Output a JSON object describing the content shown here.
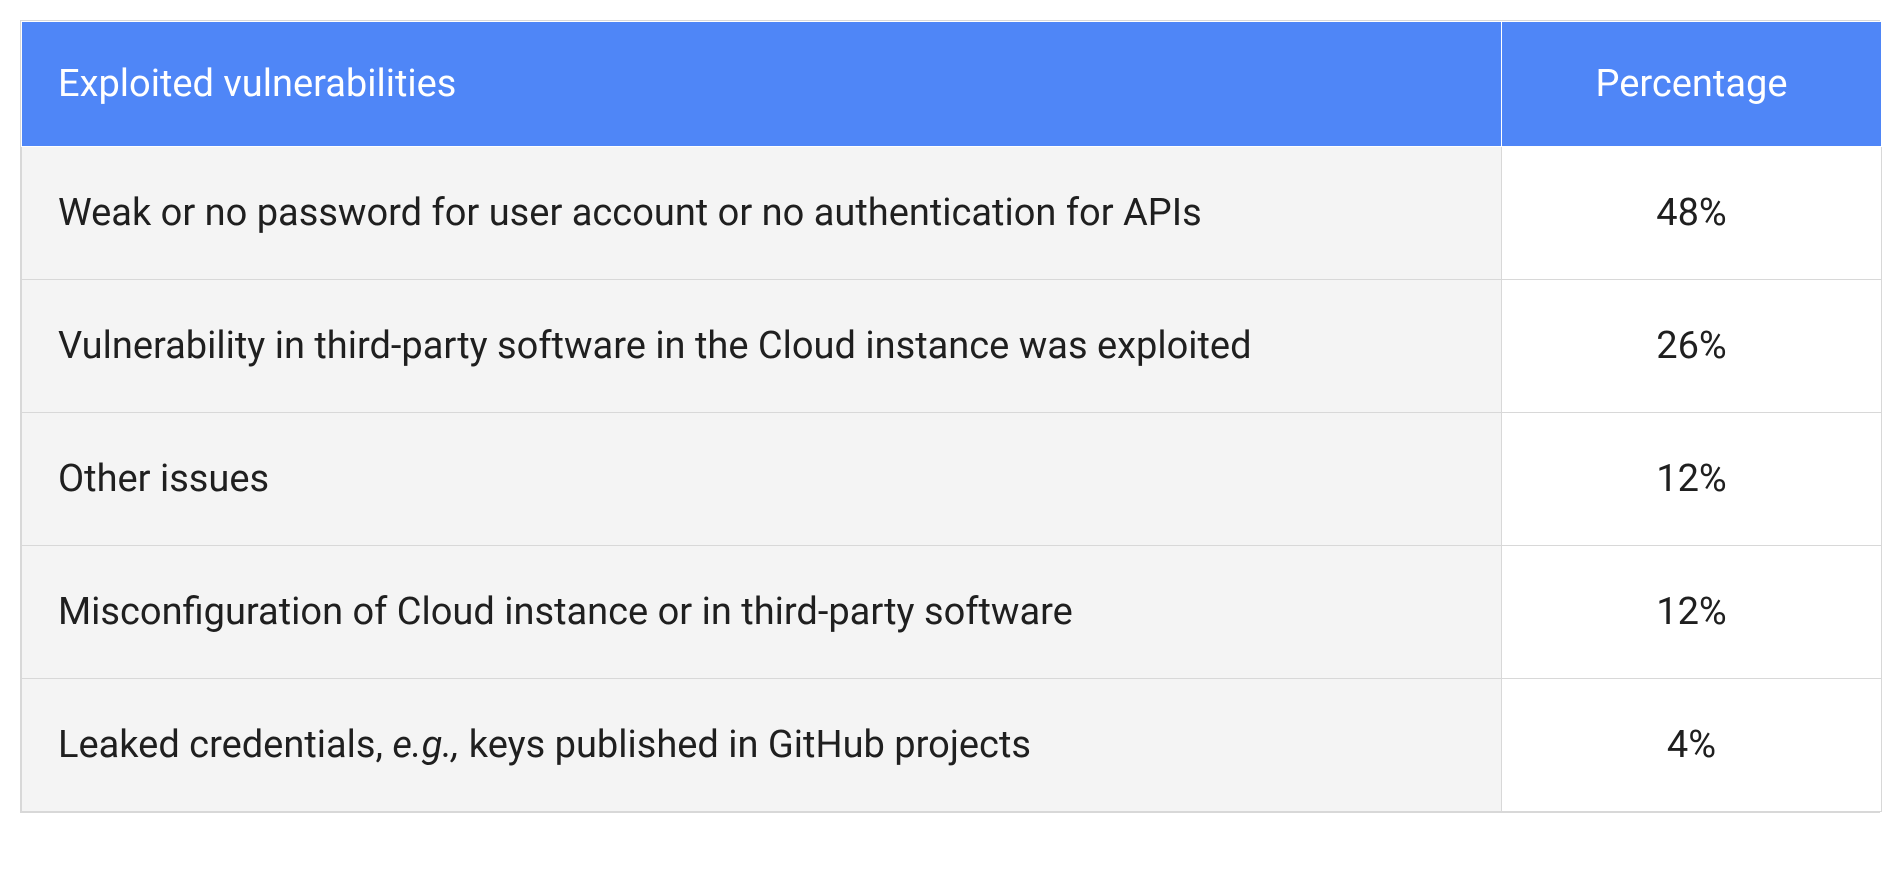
{
  "chart_data": {
    "type": "table",
    "columns": [
      "Exploited vulnerabilities",
      "Percentage"
    ],
    "rows": [
      {
        "label": "Weak or no password for user account or no authentication for APIs",
        "percentage": "48%"
      },
      {
        "label": "Vulnerability in third-party software in the Cloud instance was exploited",
        "percentage": "26%"
      },
      {
        "label": "Other issues",
        "percentage": "12%"
      },
      {
        "label": "Misconfiguration of Cloud instance or in third-party software",
        "percentage": "12%"
      },
      {
        "label_prefix": "Leaked credentials, ",
        "label_em": "e.g.,",
        "label_suffix": " keys published in GitHub projects",
        "percentage": "4%"
      }
    ]
  }
}
